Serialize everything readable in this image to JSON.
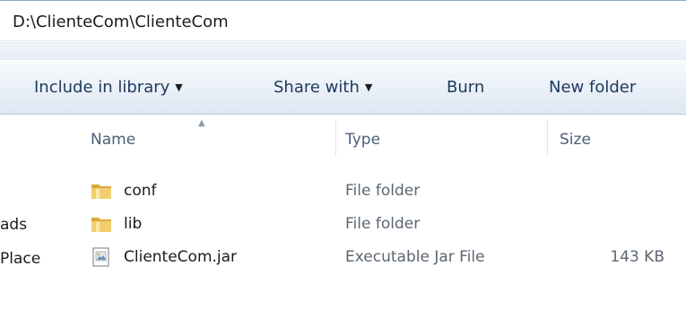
{
  "address": {
    "path": "D:\\ClienteCom\\ClienteCom"
  },
  "toolbar": {
    "include_label": "Include in library",
    "share_label": "Share with",
    "burn_label": "Burn",
    "new_folder_label": "New folder",
    "dropdown_glyph": "▼"
  },
  "nav": {
    "items": [
      {
        "label": "›"
      },
      {
        "label": "ads"
      },
      {
        "label": "Place"
      }
    ]
  },
  "columns": {
    "name": "Name",
    "type": "Type",
    "size": "Size",
    "sort_glyph": "▲"
  },
  "files": [
    {
      "name": "conf",
      "type": "File folder",
      "size": "",
      "icon": "folder-icon"
    },
    {
      "name": "lib",
      "type": "File folder",
      "size": "",
      "icon": "folder-icon"
    },
    {
      "name": "ClienteCom.jar",
      "type": "Executable Jar File",
      "size": "143 KB",
      "icon": "jar-file-icon"
    }
  ],
  "colors": {
    "toolbar_text": "#1e395b",
    "header_text": "#4c607a",
    "folder": "#e8c15a"
  }
}
